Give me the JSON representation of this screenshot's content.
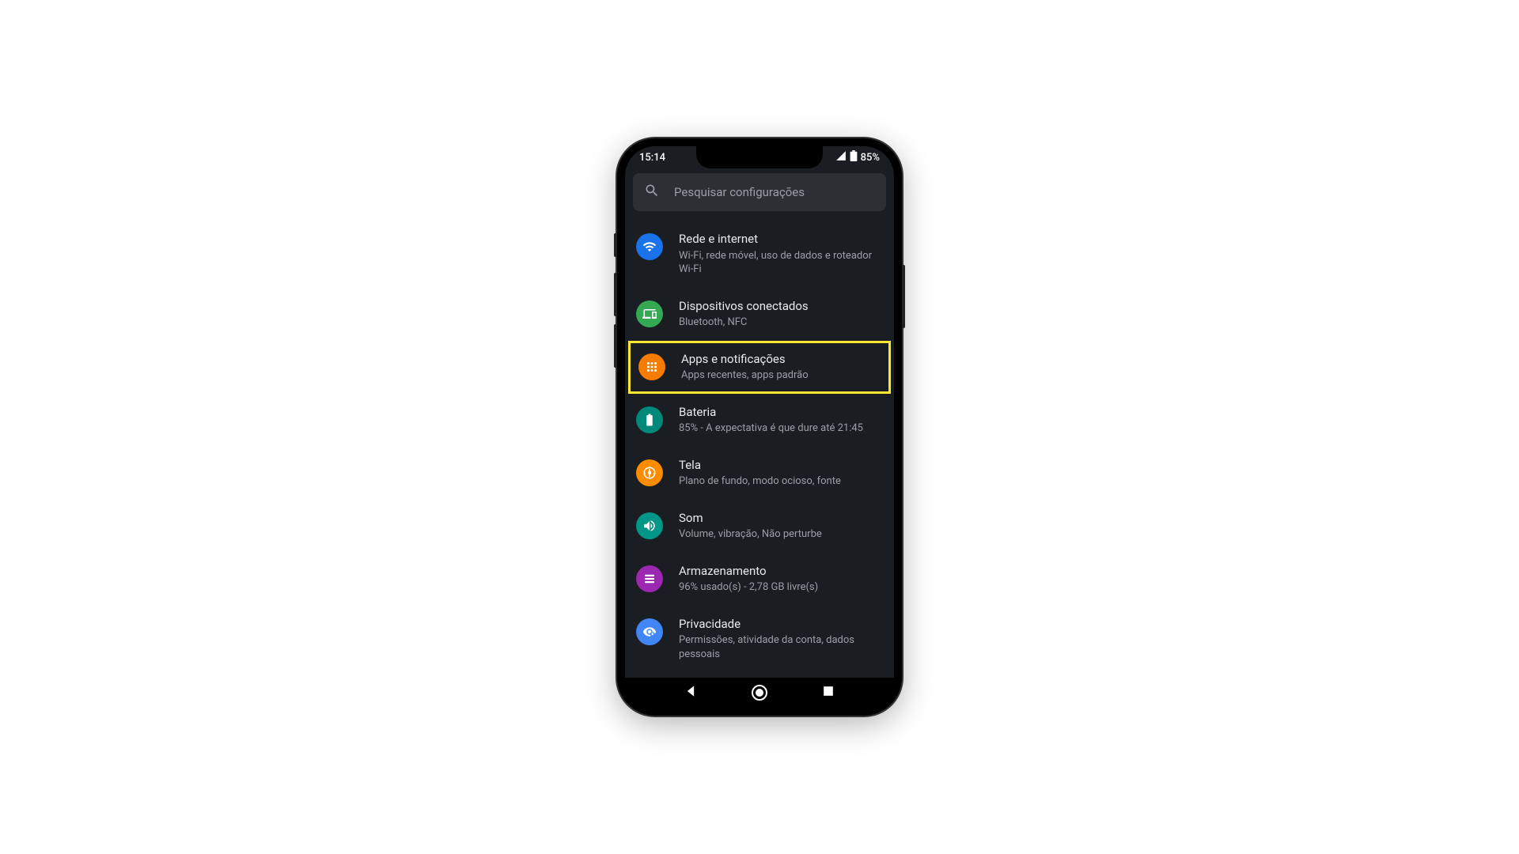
{
  "status": {
    "time": "15:14",
    "battery": "85%"
  },
  "search": {
    "placeholder": "Pesquisar configurações"
  },
  "items": [
    {
      "icon": "wifi",
      "color": "bg-blue",
      "title": "Rede e internet",
      "subtitle": "Wi-Fi, rede móvel, uso de dados e roteador Wi-Fi",
      "highlighted": false
    },
    {
      "icon": "devices",
      "color": "bg-green",
      "title": "Dispositivos conectados",
      "subtitle": "Bluetooth, NFC",
      "highlighted": false
    },
    {
      "icon": "apps",
      "color": "bg-orange",
      "title": "Apps e notificações",
      "subtitle": "Apps recentes, apps padrão",
      "highlighted": true
    },
    {
      "icon": "battery",
      "color": "bg-teal",
      "title": "Bateria",
      "subtitle": "85% - A expectativa é que dure até 21:45",
      "highlighted": false
    },
    {
      "icon": "display",
      "color": "bg-orange2",
      "title": "Tela",
      "subtitle": "Plano de fundo, modo ocioso, fonte",
      "highlighted": false
    },
    {
      "icon": "sound",
      "color": "bg-teal2",
      "title": "Som",
      "subtitle": "Volume, vibração, Não perturbe",
      "highlighted": false
    },
    {
      "icon": "storage",
      "color": "bg-purple",
      "title": "Armazenamento",
      "subtitle": "96% usado(s) - 2,78 GB livre(s)",
      "highlighted": false
    },
    {
      "icon": "privacy",
      "color": "bg-blue2",
      "title": "Privacidade",
      "subtitle": "Permissões, atividade da conta, dados pessoais",
      "highlighted": false
    }
  ]
}
